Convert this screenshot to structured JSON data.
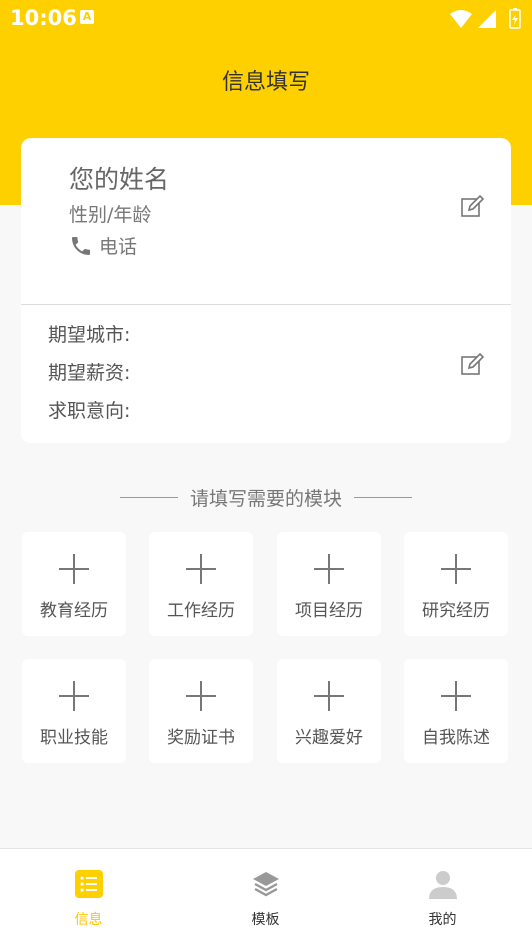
{
  "status_bar": {
    "time": "10:06",
    "app_icon": "A"
  },
  "header": {
    "title": "信息填写"
  },
  "profile": {
    "name": "您的姓名",
    "gender_age": "性别/年龄",
    "phone": "电话"
  },
  "expectations": {
    "city": "期望城市:",
    "salary": "期望薪资:",
    "intention": "求职意向:"
  },
  "modules_section": {
    "title": "请填写需要的模块",
    "items": [
      {
        "label": "教育经历"
      },
      {
        "label": "工作经历"
      },
      {
        "label": "项目经历"
      },
      {
        "label": "研究经历"
      },
      {
        "label": "职业技能"
      },
      {
        "label": "奖励证书"
      },
      {
        "label": "兴趣爱好"
      },
      {
        "label": "自我陈述"
      }
    ]
  },
  "bottom_nav": {
    "items": [
      {
        "label": "信息",
        "icon": "list-icon",
        "active": true
      },
      {
        "label": "模板",
        "icon": "layers-icon",
        "active": false
      },
      {
        "label": "我的",
        "icon": "user-icon",
        "active": false
      }
    ]
  },
  "colors": {
    "accent": "#FFD000",
    "active_nav": "#FFC400"
  }
}
